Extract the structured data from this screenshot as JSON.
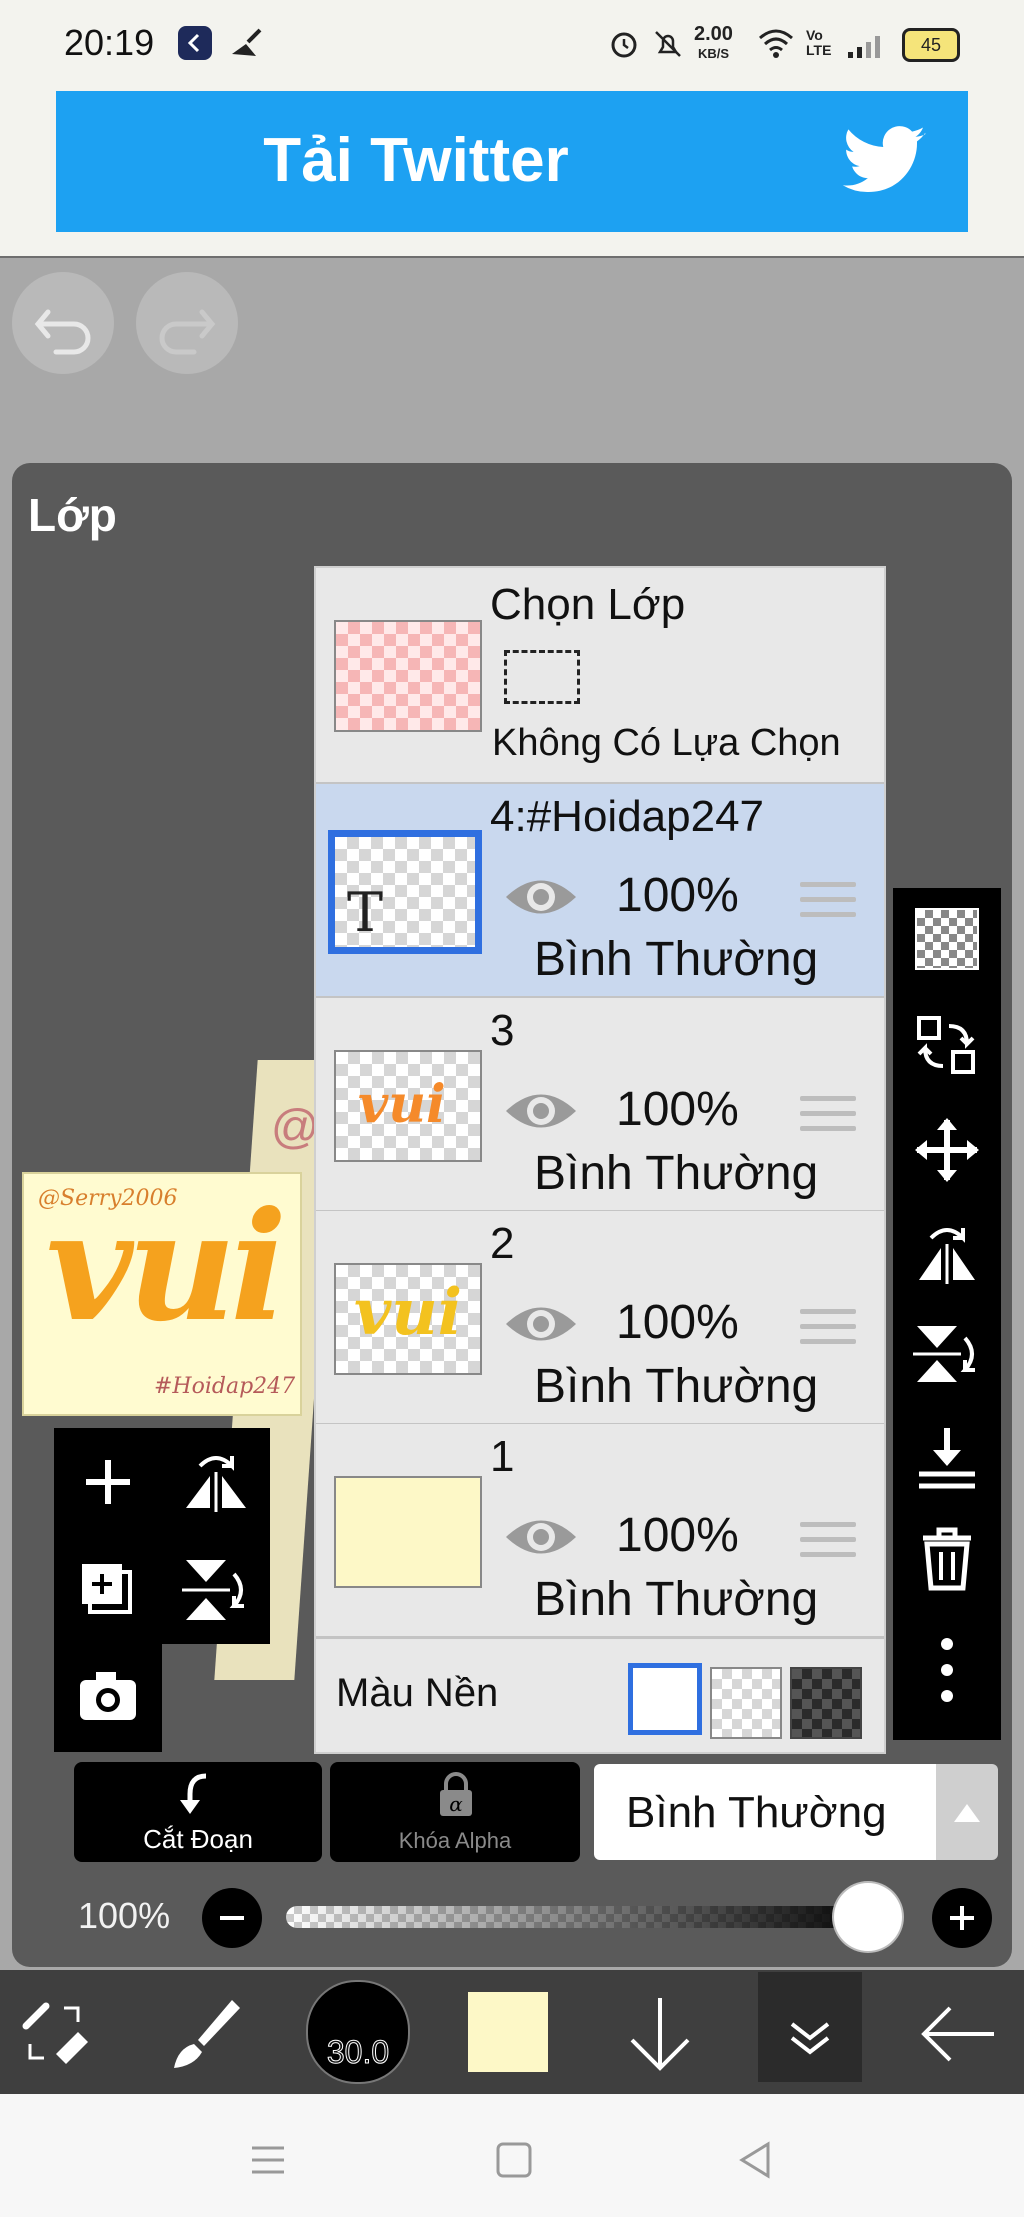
{
  "status": {
    "time": "20:19",
    "net_speed": "2.00",
    "net_unit": "KB/S",
    "volte": "Vo LTE",
    "battery": "45"
  },
  "ad": {
    "text": "Tải Twitter",
    "icon": "twitter-bird-icon"
  },
  "panel": {
    "title": "Lớp",
    "select_layer": {
      "title": "Chọn Lớp",
      "subtitle": "Không Có Lựa Chọn"
    },
    "layers": [
      {
        "name": "4:#Hoidap247",
        "opacity": "100%",
        "blend": "Bình Thường",
        "selected": true
      },
      {
        "name": "3",
        "opacity": "100%",
        "blend": "Bình Thường",
        "selected": false
      },
      {
        "name": "2",
        "opacity": "100%",
        "blend": "Bình Thường",
        "selected": false
      },
      {
        "name": "1",
        "opacity": "100%",
        "blend": "Bình Thường",
        "selected": false
      }
    ],
    "background_label": "Màu Nền"
  },
  "preview": {
    "author": "@Serry2006",
    "word": "vui",
    "tag": "#Hoidap247"
  },
  "controls": {
    "clipping_label": "Cắt Đoạn",
    "alpha_lock_label": "Khóa Alpha",
    "blend_mode_value": "Bình Thường",
    "opacity_label": "100%",
    "opacity_value": 1.0
  },
  "toolbar": {
    "brush_size": "30.0",
    "current_color": "#fdf8c7"
  },
  "colors": {
    "accent_blue": "#2f6fe0",
    "twitter_blue": "#1da1f2",
    "selected_row": "#c9d8ee"
  }
}
